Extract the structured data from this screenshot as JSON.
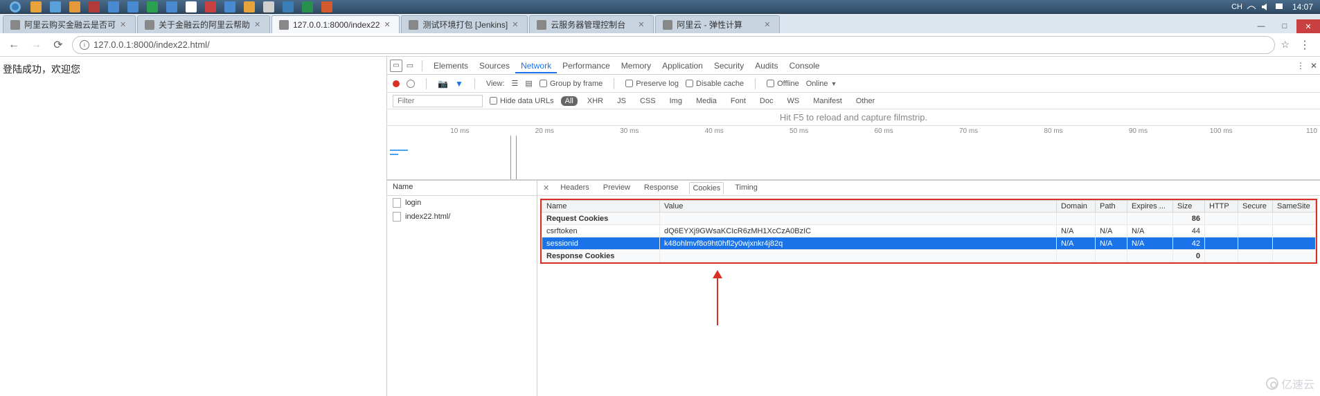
{
  "systray": {
    "time": "14:07",
    "ime": "CH"
  },
  "browser_tabs": [
    {
      "title": "阿里云购买金融云是否可",
      "active": false
    },
    {
      "title": "关于金融云的阿里云帮助",
      "active": false
    },
    {
      "title": "127.0.0.1:8000/index22",
      "active": true
    },
    {
      "title": "测试环境打包 [Jenkins]",
      "active": false
    },
    {
      "title": "云服务器管理控制台",
      "active": false
    },
    {
      "title": "阿里云 - 弹性计算",
      "active": false
    }
  ],
  "address": {
    "url": "127.0.0.1:8000/index22.html/"
  },
  "page": {
    "welcome": "登陆成功，欢迎您"
  },
  "devtools": {
    "main_tabs": [
      "Elements",
      "Sources",
      "Network",
      "Performance",
      "Memory",
      "Application",
      "Security",
      "Audits",
      "Console"
    ],
    "active_tab": "Network",
    "toolbar": {
      "view": "View:",
      "group": "Group by frame",
      "preserve": "Preserve log",
      "disable": "Disable cache",
      "offline": "Offline",
      "online": "Online"
    },
    "filter": {
      "placeholder": "Filter",
      "hide_urls": "Hide data URLs",
      "types": [
        "All",
        "XHR",
        "JS",
        "CSS",
        "Img",
        "Media",
        "Font",
        "Doc",
        "WS",
        "Manifest",
        "Other"
      ]
    },
    "filmstrip": "Hit F5 to reload and capture filmstrip.",
    "timeline_ticks": [
      "10 ms",
      "20 ms",
      "30 ms",
      "40 ms",
      "50 ms",
      "60 ms",
      "70 ms",
      "80 ms",
      "90 ms",
      "100 ms",
      "110"
    ],
    "reqlist": {
      "header": "Name",
      "rows": [
        "login",
        "index22.html/"
      ]
    },
    "detail_tabs": [
      "Headers",
      "Preview",
      "Response",
      "Cookies",
      "Timing"
    ],
    "active_detail": "Cookies",
    "cookie_cols": [
      "Name",
      "Value",
      "Domain",
      "Path",
      "Expires ...",
      "Size",
      "HTTP",
      "Secure",
      "SameSite"
    ],
    "cookie_sections": {
      "request": {
        "label": "Request Cookies",
        "total_size": "86"
      },
      "response": {
        "label": "Response Cookies",
        "total_size": "0"
      }
    },
    "cookies": [
      {
        "name": "csrftoken",
        "value": "dQ6EYXj9GWsaKCIcR6zMH1XcCzA0BzIC",
        "domain": "N/A",
        "path": "N/A",
        "expires": "N/A",
        "size": "44",
        "http": "",
        "secure": "",
        "samesite": "",
        "selected": false
      },
      {
        "name": "sessionid",
        "value": "k48ohlmvf8o9ht0hfl2y0wjxnkr4j82q",
        "domain": "N/A",
        "path": "N/A",
        "expires": "N/A",
        "size": "42",
        "http": "",
        "secure": "",
        "samesite": "",
        "selected": true
      }
    ]
  },
  "watermark": "亿速云"
}
